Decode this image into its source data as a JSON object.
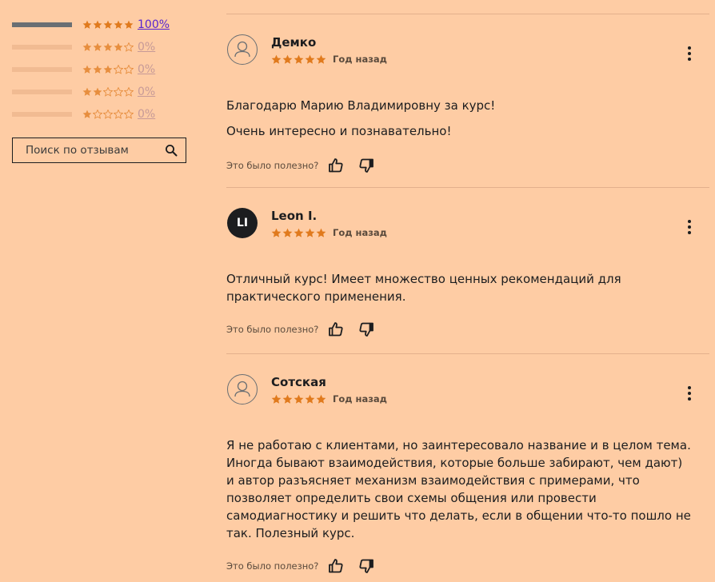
{
  "ratings": [
    {
      "stars": 5,
      "fill_fraction": 1.0,
      "percent": "100%"
    },
    {
      "stars": 4,
      "fill_fraction": 0.0,
      "percent": "0%"
    },
    {
      "stars": 3,
      "fill_fraction": 0.0,
      "percent": "0%"
    },
    {
      "stars": 2,
      "fill_fraction": 0.0,
      "percent": "0%"
    },
    {
      "stars": 1,
      "fill_fraction": 0.0,
      "percent": "0%"
    }
  ],
  "search": {
    "placeholder": "Поиск по отзывам",
    "icon": "search-icon"
  },
  "reviews": [
    {
      "name": "Демко",
      "avatar": {
        "type": "user-icon",
        "initials": ""
      },
      "rating": 5,
      "date": "Год назад",
      "body": [
        "Благодарю Марию Владимировну за курс!",
        "Очень интересно и познавательно!"
      ],
      "helpful_label": "Это было полезно?"
    },
    {
      "name": "Leon I.",
      "avatar": {
        "type": "initials",
        "initials": "LI"
      },
      "rating": 5,
      "date": "Год назад",
      "body": [
        "Отличный курс! Имеет множество ценных рекомендаций для практического применения."
      ],
      "helpful_label": "Это было полезно?"
    },
    {
      "name": "Сотская",
      "avatar": {
        "type": "user-icon",
        "initials": ""
      },
      "rating": 5,
      "date": "Год назад",
      "body": [
        "Я не работаю с клиентами, но заинтересовало название и в целом тема. Иногда бывают взаимодействия, которые больше забирают, чем дают) и автор разъясняет механизм взаимодействия с примерами, что позволяет определить свои схемы общения или провести самодиагностику и решить что делать, если в общении что-то пошло не так. Полезный курс."
      ],
      "helpful_label": "Это было полезно?"
    }
  ],
  "colors": {
    "background": "#fecca4",
    "star": "#e07a1d",
    "bar_filled": "#6a6f73",
    "percent_link": "#5624d0",
    "text": "#1c1d1f"
  }
}
